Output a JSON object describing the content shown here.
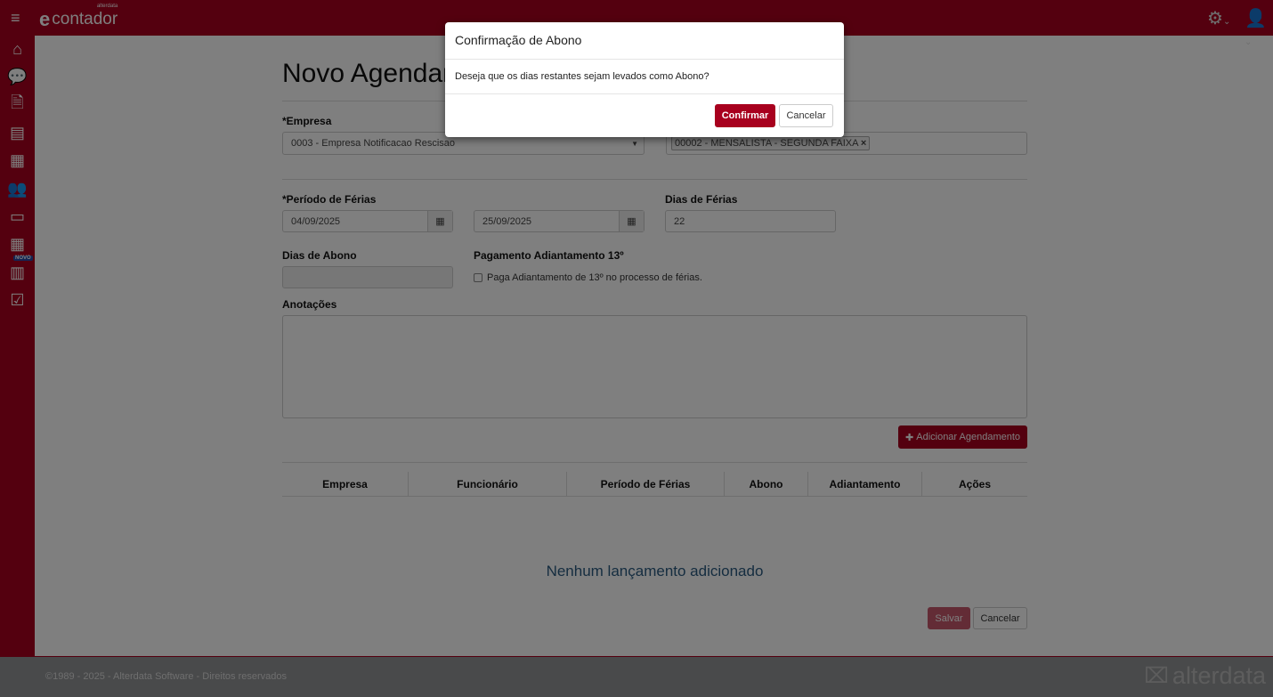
{
  "app": {
    "logo_text": "contador",
    "logo_sup": "alterdata",
    "brand_color": "#a8001e"
  },
  "sidebar": {
    "items": [
      {
        "icon": "home-icon",
        "glyph": "⌂"
      },
      {
        "icon": "chat-icon",
        "glyph": "💬"
      },
      {
        "icon": "document-icon",
        "glyph": "🗎"
      },
      {
        "icon": "contact-card-icon",
        "glyph": "▤"
      },
      {
        "icon": "building-icon",
        "glyph": "▦"
      },
      {
        "icon": "users-icon",
        "glyph": "👥"
      },
      {
        "icon": "credit-card-icon",
        "glyph": "▭"
      },
      {
        "icon": "calculator-icon",
        "glyph": "▦",
        "badge": "NOVO"
      },
      {
        "icon": "bar-chart-icon",
        "glyph": "▥"
      },
      {
        "icon": "checkbox-icon",
        "glyph": "☑"
      }
    ]
  },
  "page": {
    "title": "Novo Agendamento"
  },
  "form": {
    "empresa_label": "*Empresa",
    "empresa_value": "0003 - Empresa Notificacao Rescisao",
    "funcionario_tag": "00002 - MENSALISTA - SEGUNDA FAIXA",
    "periodo_label": "*Período de Férias",
    "periodo_inicio": "04/09/2025",
    "periodo_fim": "25/09/2025",
    "dias_ferias_label": "Dias de Férias",
    "dias_ferias_value": "22",
    "dias_abono_label": "Dias de Abono",
    "dias_abono_value": "",
    "adiantamento_label": "Pagamento Adiantamento 13º",
    "adiantamento_checkbox": "Paga Adiantamento de 13º no processo de férias.",
    "adiantamento_checked": false,
    "anotacoes_label": "Anotações",
    "anotacoes_value": "",
    "add_button": "Adicionar Agendamento"
  },
  "table": {
    "columns": [
      "Empresa",
      "Funcionário",
      "Período de Férias",
      "Abono",
      "Adiantamento",
      "Ações"
    ],
    "empty_message": "Nenhum lançamento adicionado"
  },
  "actions": {
    "save": "Salvar",
    "cancel": "Cancelar"
  },
  "footer": {
    "copyright": "©1989 - 2025 - Alterdata Software - Direitos reservados",
    "brand": "alterdata"
  },
  "modal": {
    "title": "Confirmação de Abono",
    "message": "Deseja que os dias restantes sejam levados como Abono?",
    "confirm": "Confirmar",
    "cancel": "Cancelar"
  }
}
